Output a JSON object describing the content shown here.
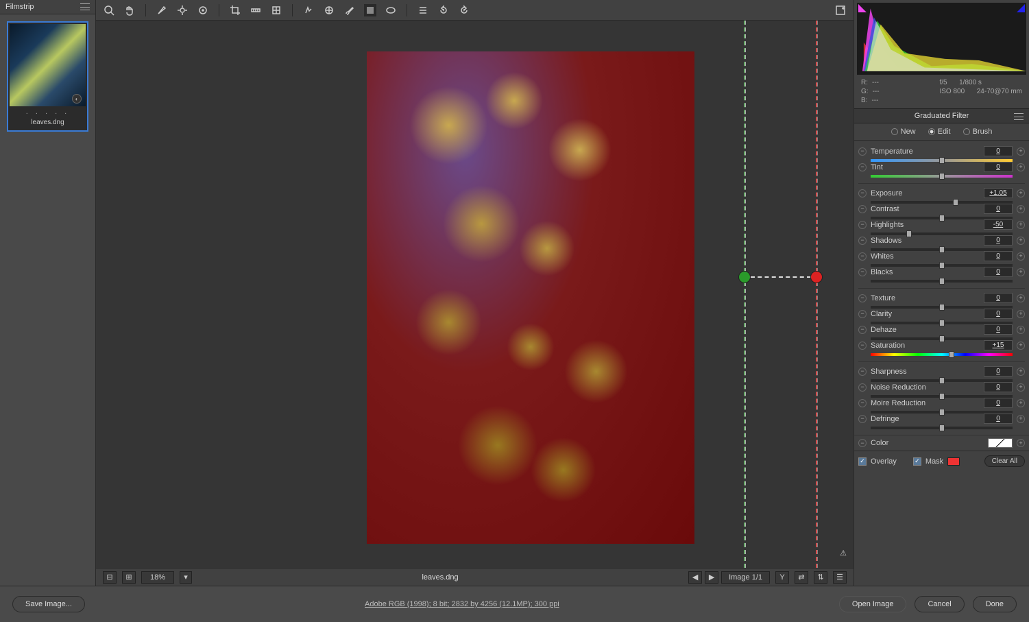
{
  "filmstrip": {
    "title": "Filmstrip",
    "thumb_label": "leaves.dng",
    "dots": ". . . . ."
  },
  "toolbar": {
    "icons": [
      "zoom",
      "hand",
      "eyedropper",
      "sampler",
      "targeted",
      "crop",
      "straighten",
      "guides",
      "spot",
      "redeye",
      "brush",
      "square",
      "ellipse",
      "list",
      "undo",
      "redo"
    ]
  },
  "canvas": {
    "filename": "leaves.dng",
    "zoom": "18%",
    "counter": "Image 1/1"
  },
  "histogram": {
    "r": "---",
    "g": "---",
    "b": "---",
    "aperture": "f/5",
    "shutter": "1/800 s",
    "iso": "ISO 800",
    "lens": "24-70@70 mm"
  },
  "panel": {
    "title": "Graduated Filter",
    "modes": {
      "new": "New",
      "edit": "Edit",
      "brush": "Brush",
      "selected": "edit"
    }
  },
  "sliders": {
    "temperature": {
      "label": "Temperature",
      "val": "0",
      "pos": 50
    },
    "tint": {
      "label": "Tint",
      "val": "0",
      "pos": 50
    },
    "exposure": {
      "label": "Exposure",
      "val": "+1.05",
      "pos": 60
    },
    "contrast": {
      "label": "Contrast",
      "val": "0",
      "pos": 50
    },
    "highlights": {
      "label": "Highlights",
      "val": "-50",
      "pos": 27
    },
    "shadows": {
      "label": "Shadows",
      "val": "0",
      "pos": 50
    },
    "whites": {
      "label": "Whites",
      "val": "0",
      "pos": 50
    },
    "blacks": {
      "label": "Blacks",
      "val": "0",
      "pos": 50
    },
    "texture": {
      "label": "Texture",
      "val": "0",
      "pos": 50
    },
    "clarity": {
      "label": "Clarity",
      "val": "0",
      "pos": 50
    },
    "dehaze": {
      "label": "Dehaze",
      "val": "0",
      "pos": 50
    },
    "saturation": {
      "label": "Saturation",
      "val": "+15",
      "pos": 57
    },
    "sharpness": {
      "label": "Sharpness",
      "val": "0",
      "pos": 50
    },
    "noise": {
      "label": "Noise Reduction",
      "val": "0",
      "pos": 50
    },
    "moire": {
      "label": "Moire Reduction",
      "val": "0",
      "pos": 50
    },
    "defringe": {
      "label": "Defringe",
      "val": "0",
      "pos": 50
    }
  },
  "color_row": {
    "label": "Color"
  },
  "overlay": {
    "overlay": "Overlay",
    "mask": "Mask",
    "clear": "Clear All"
  },
  "footer": {
    "save": "Save Image...",
    "info": "Adobe RGB (1998); 8 bit; 2832 by 4256 (12.1MP); 300 ppi",
    "open": "Open Image",
    "cancel": "Cancel",
    "done": "Done"
  }
}
